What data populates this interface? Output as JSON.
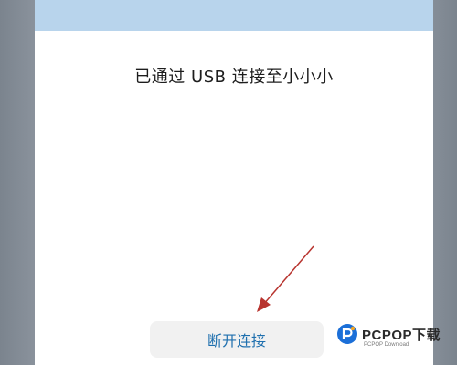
{
  "dialog": {
    "message": "已通过 USB 连接至小小小",
    "disconnect_label": "断开连接"
  },
  "watermark": {
    "brand": "PCPOP下载",
    "sub": "PCPOP Download"
  },
  "colors": {
    "top_band": "#b8d4ec",
    "button_text": "#1e6fae",
    "arrow": "#b8342f"
  }
}
